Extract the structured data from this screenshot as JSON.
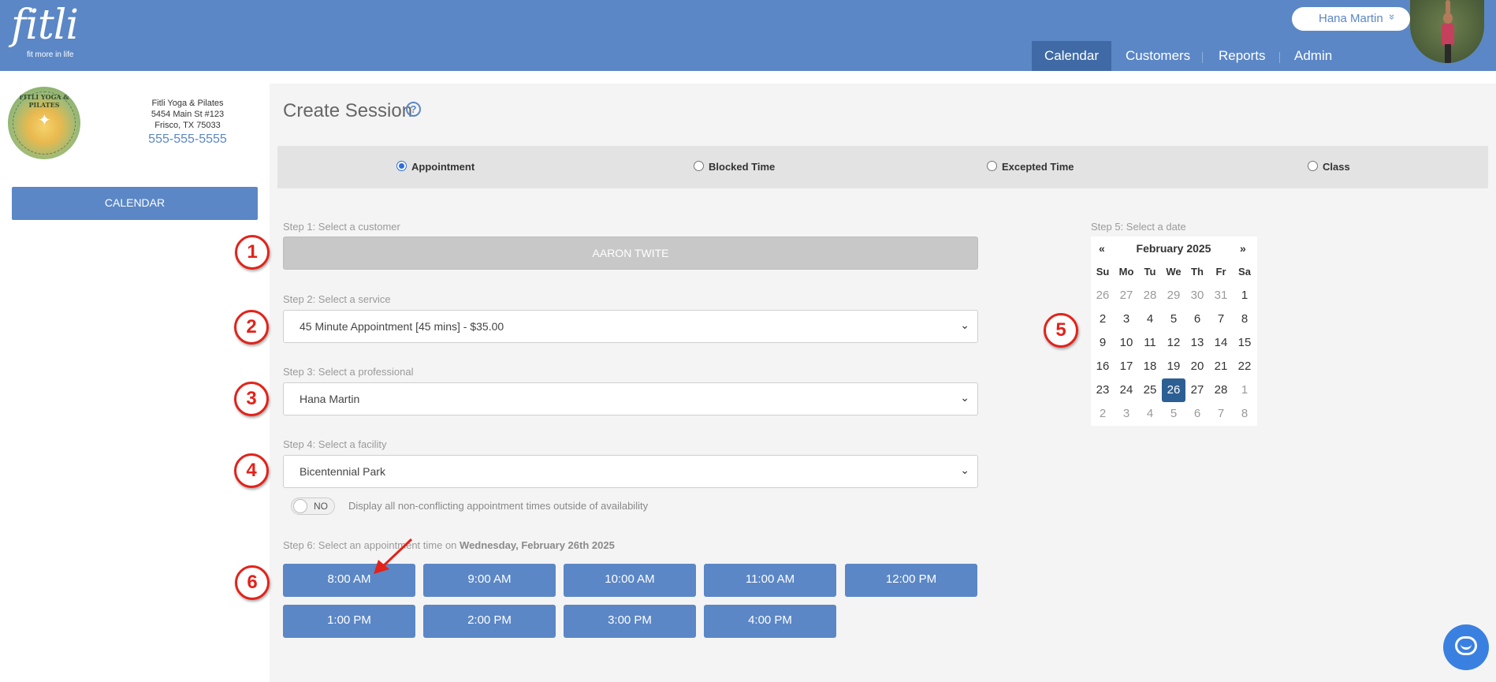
{
  "header": {
    "logo_text": "fitli",
    "logo_tagline": "fit more in life",
    "user_name": "Hana Martin",
    "user_chevron": "»",
    "nav": [
      {
        "label": "Calendar",
        "active": true
      },
      {
        "label": "Customers",
        "active": false
      },
      {
        "label": "Reports",
        "active": false
      },
      {
        "label": "Admin",
        "active": false
      }
    ]
  },
  "sidebar": {
    "business_logo_text": "FITLI YOGA & PILATES",
    "business_name": "Fitli Yoga & Pilates",
    "address_line1": "5454 Main St #123",
    "address_line2": "Frisco, TX 75033",
    "phone": "555-555-5555",
    "calendar_button": "CALENDAR"
  },
  "main": {
    "title": "Create Session",
    "help_icon": "?",
    "session_types": [
      {
        "label": "Appointment",
        "selected": true
      },
      {
        "label": "Blocked Time",
        "selected": false
      },
      {
        "label": "Excepted Time",
        "selected": false
      },
      {
        "label": "Class",
        "selected": false
      }
    ],
    "step1": {
      "label": "Step 1: Select a customer",
      "value": "AARON TWITE"
    },
    "step2": {
      "label": "Step 2: Select a service",
      "value": "45 Minute Appointment [45 mins] - $35.00"
    },
    "step3": {
      "label": "Step 3: Select a professional",
      "value": "Hana Martin"
    },
    "step4": {
      "label": "Step 4: Select a facility",
      "value": "Bicentennial Park"
    },
    "toggle": {
      "state": "NO",
      "text": "Display all non-conflicting appointment times outside of availability"
    },
    "step5": {
      "label": "Step 5: Select a date"
    },
    "step6": {
      "label": "Step 6: Select an appointment time on",
      "date": "Wednesday, February 26th 2025"
    },
    "times": [
      "8:00 AM",
      "9:00 AM",
      "10:00 AM",
      "11:00 AM",
      "12:00 PM",
      "1:00 PM",
      "2:00 PM",
      "3:00 PM",
      "4:00 PM"
    ],
    "badges": [
      "1",
      "2",
      "3",
      "4",
      "5",
      "6"
    ]
  },
  "calendar": {
    "prev": "«",
    "next": "»",
    "month_label": "February 2025",
    "weekdays": [
      "Su",
      "Mo",
      "Tu",
      "We",
      "Th",
      "Fr",
      "Sa"
    ],
    "weeks": [
      [
        "26",
        "27",
        "28",
        "29",
        "30",
        "31",
        "1"
      ],
      [
        "2",
        "3",
        "4",
        "5",
        "6",
        "7",
        "8"
      ],
      [
        "9",
        "10",
        "11",
        "12",
        "13",
        "14",
        "15"
      ],
      [
        "16",
        "17",
        "18",
        "19",
        "20",
        "21",
        "22"
      ],
      [
        "23",
        "24",
        "25",
        "26",
        "27",
        "28",
        "1"
      ],
      [
        "2",
        "3",
        "4",
        "5",
        "6",
        "7",
        "8"
      ]
    ],
    "muted_first_row_count": 6,
    "muted_last_row_from": 5,
    "selected_day": "26"
  },
  "colors": {
    "brand_blue": "#5b87c6",
    "nav_active": "#3f6aa6",
    "selected_day": "#2c5f93",
    "badge_red": "#e2231a",
    "chat_blue": "#3a80e0"
  }
}
